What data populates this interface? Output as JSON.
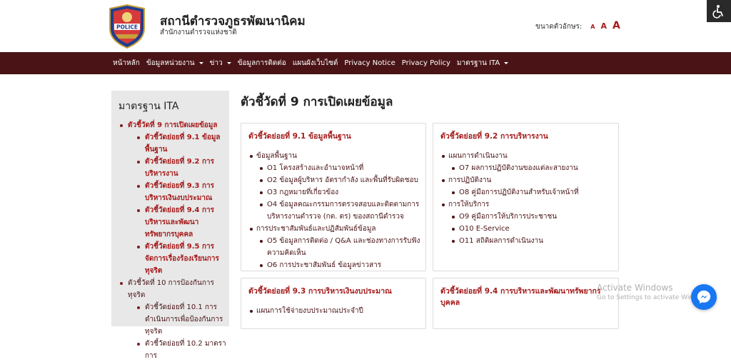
{
  "header": {
    "logo_text": "POLICE",
    "site_title": "สถานีตำรวจภูธรพัฒนานิคม",
    "site_subtitle": "สำนักงานตำรวจแห่งชาติ",
    "font_size_label": "ขนาดตัวอักษร:",
    "font_sizes": [
      "A",
      "A",
      "A"
    ]
  },
  "nav": {
    "items": [
      {
        "label": "หน้าหลัก"
      },
      {
        "label": "ข้อมูลหน่วยงาน"
      },
      {
        "label": "ข่าว"
      },
      {
        "label": "ข้อมูลการติดต่อ"
      },
      {
        "label": "แผนผังเว็บไซต์"
      },
      {
        "label": "Privacy Notice"
      },
      {
        "label": "Privacy Policy"
      },
      {
        "label": "มาตรฐาน ITA"
      }
    ]
  },
  "sidebar": {
    "title": "มาตรฐาน ITA",
    "items": [
      {
        "label": "ตัวชี้วัดที่ 9 การเปิดเผยข้อมูล"
      },
      {
        "label": "ตัวชี้วัดย่อยที่ 9.1 ข้อมูลพื้นฐาน"
      },
      {
        "label": "ตัวชี้วัดย่อยที่ 9.2 การบริหารงาน"
      },
      {
        "label": "ตัวชี้วัดย่อยที่ 9.3 การบริหารเงินงบประมาณ"
      },
      {
        "label": "ตัวชี้วัดย่อยที่ 9.4 การบริหารและพัฒนาทรัพยากรบุคคล"
      },
      {
        "label": "ตัวชี้วัดย่อยที่ 9.5 การจัดการเรื่องร้องเรียนการทุจริต"
      },
      {
        "label": "ตัวชี้วัดที่ 10 การป้องกันการทุจริต"
      },
      {
        "label": "ตัวชี้วัดย่อยที่ 10.1 การดำเนินการเพื่อป้องกันการทุจริต"
      },
      {
        "label": "ตัวชี้วัดย่อยที่ 10.2 มาตราการ"
      }
    ]
  },
  "main": {
    "page_title": "ตัวชี้วัดที่ 9 การเปิดเผยข้อมูล",
    "cards": [
      {
        "title": "ตัวชี้วัดย่อยที่ 9.1 ข้อมูลพื้นฐาน",
        "groups": [
          {
            "label": "ข้อมูลพื้นฐาน",
            "items": [
              "O1 โครงสร้างและอำนาจหน้าที่",
              "O2 ข้อมูลผู้บริหาร อัตรากำลัง และพื้นที่รับผิดชอบ",
              "O3 กฎหมายที่เกี่ยวข้อง",
              "O4 ข้อมูลคณะกรรมการตรวจสอบและติดตามการบริหารงานตำรวจ (กต. ตร) ของสถานีตำรวจ"
            ]
          },
          {
            "label": "การประชาสัมพันธ์และปฏิสัมพันธ์ข้อมูล",
            "items": [
              "O5 ข้อมูลการติดต่อ / Q&A และช่องทางการรับฟังความคิดเห็น",
              "O6 การประชาสัมพันธ์ ข้อมูลข่าวสาร"
            ]
          }
        ]
      },
      {
        "title": "ตัวชี้วัดย่อยที่ 9.2 การบริหารงาน",
        "groups": [
          {
            "label": "แผนการดำเนินงาน",
            "items": [
              "O7 ผลการปฏิบัติงานของแต่ละสายงาน"
            ]
          },
          {
            "label": "การปฏิบัติงาน",
            "items": [
              "O8 คู่มือการปฏิบัติงานสำหรับเจ้าหน้าที่"
            ]
          },
          {
            "label": "การให้บริการ",
            "items": [
              "O9 คู่มือการให้บริการประชาชน",
              "O10 E-Service",
              "O11 สถิติผลการดำเนินงาน"
            ]
          }
        ]
      },
      {
        "title": "ตัวชี้วัดย่อยที่ 9.3 การบริหารเงินงบประมาณ",
        "groups": [
          {
            "label": "แผนการใช้จ่ายงบประมาณประจำปี",
            "items": []
          }
        ]
      },
      {
        "title": "ตัวชี้วัดย่อยที่ 9.4 การบริหารและพัฒนาทรัพยากรบุคคล",
        "groups": []
      }
    ]
  },
  "watermark": {
    "line1": "Activate Windows",
    "line2": "Go to Settings to activate Windows."
  },
  "colors": {
    "nav_bg": "#4a1417",
    "accent_red": "#a51c1c",
    "sidebar_bg": "#e8e8e8",
    "messenger": "#1877f2"
  }
}
